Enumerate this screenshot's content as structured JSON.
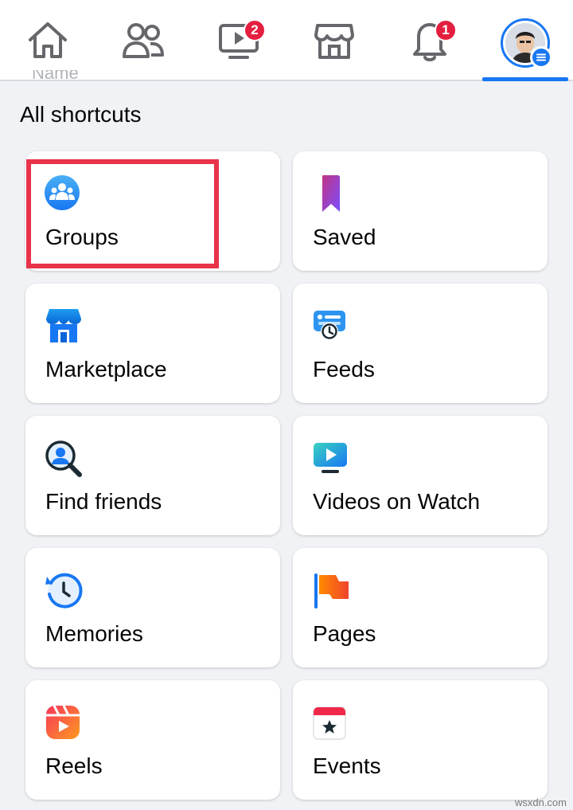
{
  "nav": {
    "tabs": [
      {
        "name": "home",
        "icon": "home-icon"
      },
      {
        "name": "friends",
        "icon": "friends-icon"
      },
      {
        "name": "watch",
        "icon": "watch-icon",
        "badge": "2"
      },
      {
        "name": "marketplace",
        "icon": "marketplace-icon"
      },
      {
        "name": "notifications",
        "icon": "bell-icon",
        "badge": "1"
      },
      {
        "name": "menu",
        "icon": "profile-menu-icon",
        "active": true
      }
    ],
    "colors": {
      "active": "#1877f2",
      "badge": "#e41e3f",
      "icon": "#65676b"
    }
  },
  "faded_text": "Name",
  "section_title": "All shortcuts",
  "shortcuts": [
    {
      "label": "Groups",
      "icon": "groups-icon",
      "highlighted": true
    },
    {
      "label": "Saved",
      "icon": "bookmark-icon"
    },
    {
      "label": "Marketplace",
      "icon": "marketplace-shop-icon"
    },
    {
      "label": "Feeds",
      "icon": "feeds-icon"
    },
    {
      "label": "Find friends",
      "icon": "find-friends-icon"
    },
    {
      "label": "Videos on Watch",
      "icon": "video-icon"
    },
    {
      "label": "Memories",
      "icon": "memories-icon"
    },
    {
      "label": "Pages",
      "icon": "flag-icon"
    },
    {
      "label": "Reels",
      "icon": "reels-icon"
    },
    {
      "label": "Events",
      "icon": "calendar-icon"
    }
  ],
  "highlight_color": "#e8334a",
  "watermark": "wsxdn.com"
}
